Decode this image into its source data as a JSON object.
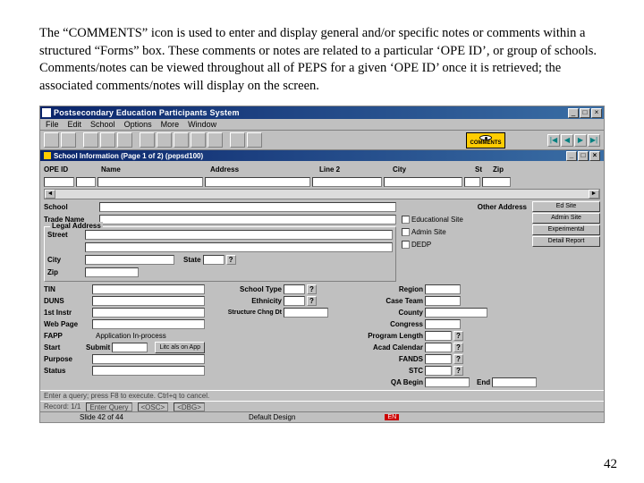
{
  "doc": {
    "paragraph": "The “COMMENTS” icon is used to enter and display general and/or specific notes or comments within a structured “Forms” box.  These comments or notes are related to a particular ‘OPE ID’,  or group of schools.  Comments/notes can be viewed throughout all of PEPS for a given ‘OPE ID’ once it is retrieved; the associated comments/notes will display on the screen.",
    "page_number": "42"
  },
  "window": {
    "title": "Postsecondary Education Participants System",
    "menus": [
      "File",
      "Edit",
      "School",
      "Options",
      "More",
      "Window"
    ],
    "comments_label": "COMMENTS",
    "nav_icons": [
      "|◀",
      "◀",
      "▶",
      "▶|"
    ],
    "sub_title": "School Information (Page 1 of 2) (pepsd100)",
    "header_fields": {
      "ope_id": "OPE ID",
      "name": "Name",
      "address": "Address",
      "line2": "Line 2",
      "city": "City",
      "st": "St",
      "zip": "Zip"
    },
    "mid": {
      "school": "School",
      "trade_name": "Trade Name",
      "other_address": "Other Address",
      "checks": [
        "Educational Site",
        "Admin Site",
        "DEDP"
      ],
      "right_buttons": [
        "Ed Site",
        "Admin Site",
        "Experimental",
        "Detail Report"
      ]
    },
    "legal": {
      "legend": "Legal Address",
      "street": "Street",
      "city": "City",
      "state": "State",
      "zip": "Zip"
    },
    "left_labels": [
      "TIN",
      "DUNS",
      "1st Instr",
      "Web Page",
      "FAPP",
      "Start",
      "Purpose",
      "Status"
    ],
    "mid_labels": [
      "School Type",
      "Ethnicity",
      "Structure Chng Dt"
    ],
    "app_inprocess": "Application In-process",
    "submit": "Submit",
    "litc_btn": "Litc als on App",
    "right_labels": [
      "Region",
      "Case Team",
      "County",
      "Congress",
      "Program Length",
      "Acad Calendar",
      "FANDS",
      "STC",
      "QA Begin"
    ],
    "end": "End",
    "status1": {
      "hint": "Enter a query; press F8 to execute. Ctrl+q to cancel.",
      "record": "Record: 1/1",
      "enter_query": "Enter Query",
      "osc": "<OSC>",
      "dbg": "<DBG>"
    },
    "status2": {
      "slide": "Slide 42 of 44",
      "design": "Default Design"
    }
  }
}
